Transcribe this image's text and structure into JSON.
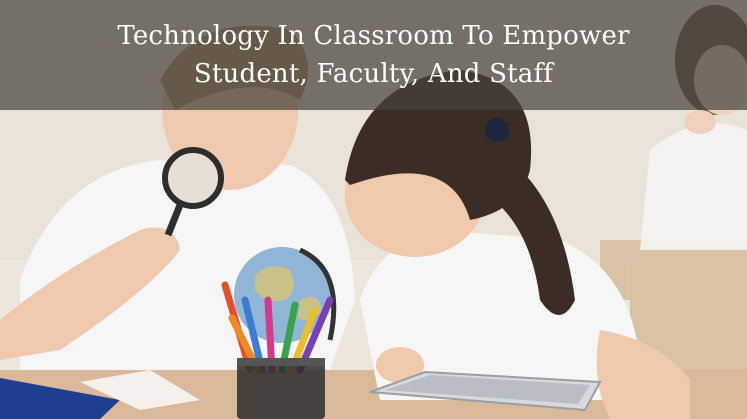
{
  "header": {
    "title_line1": "Technology In Classroom To Empower",
    "title_line2": "Student, Faculty, And Staff"
  },
  "image": {
    "subject": "two-children-examining-globe-and-tablet",
    "colors": {
      "wall": "#ece6dc",
      "desk": "#d9b99a",
      "shirt": "#f6f6f6",
      "hair_boy": "#b9946a",
      "hair_girl": "#3b2c26",
      "skin": "#f0c9ad",
      "overlay": "#46423c"
    }
  }
}
